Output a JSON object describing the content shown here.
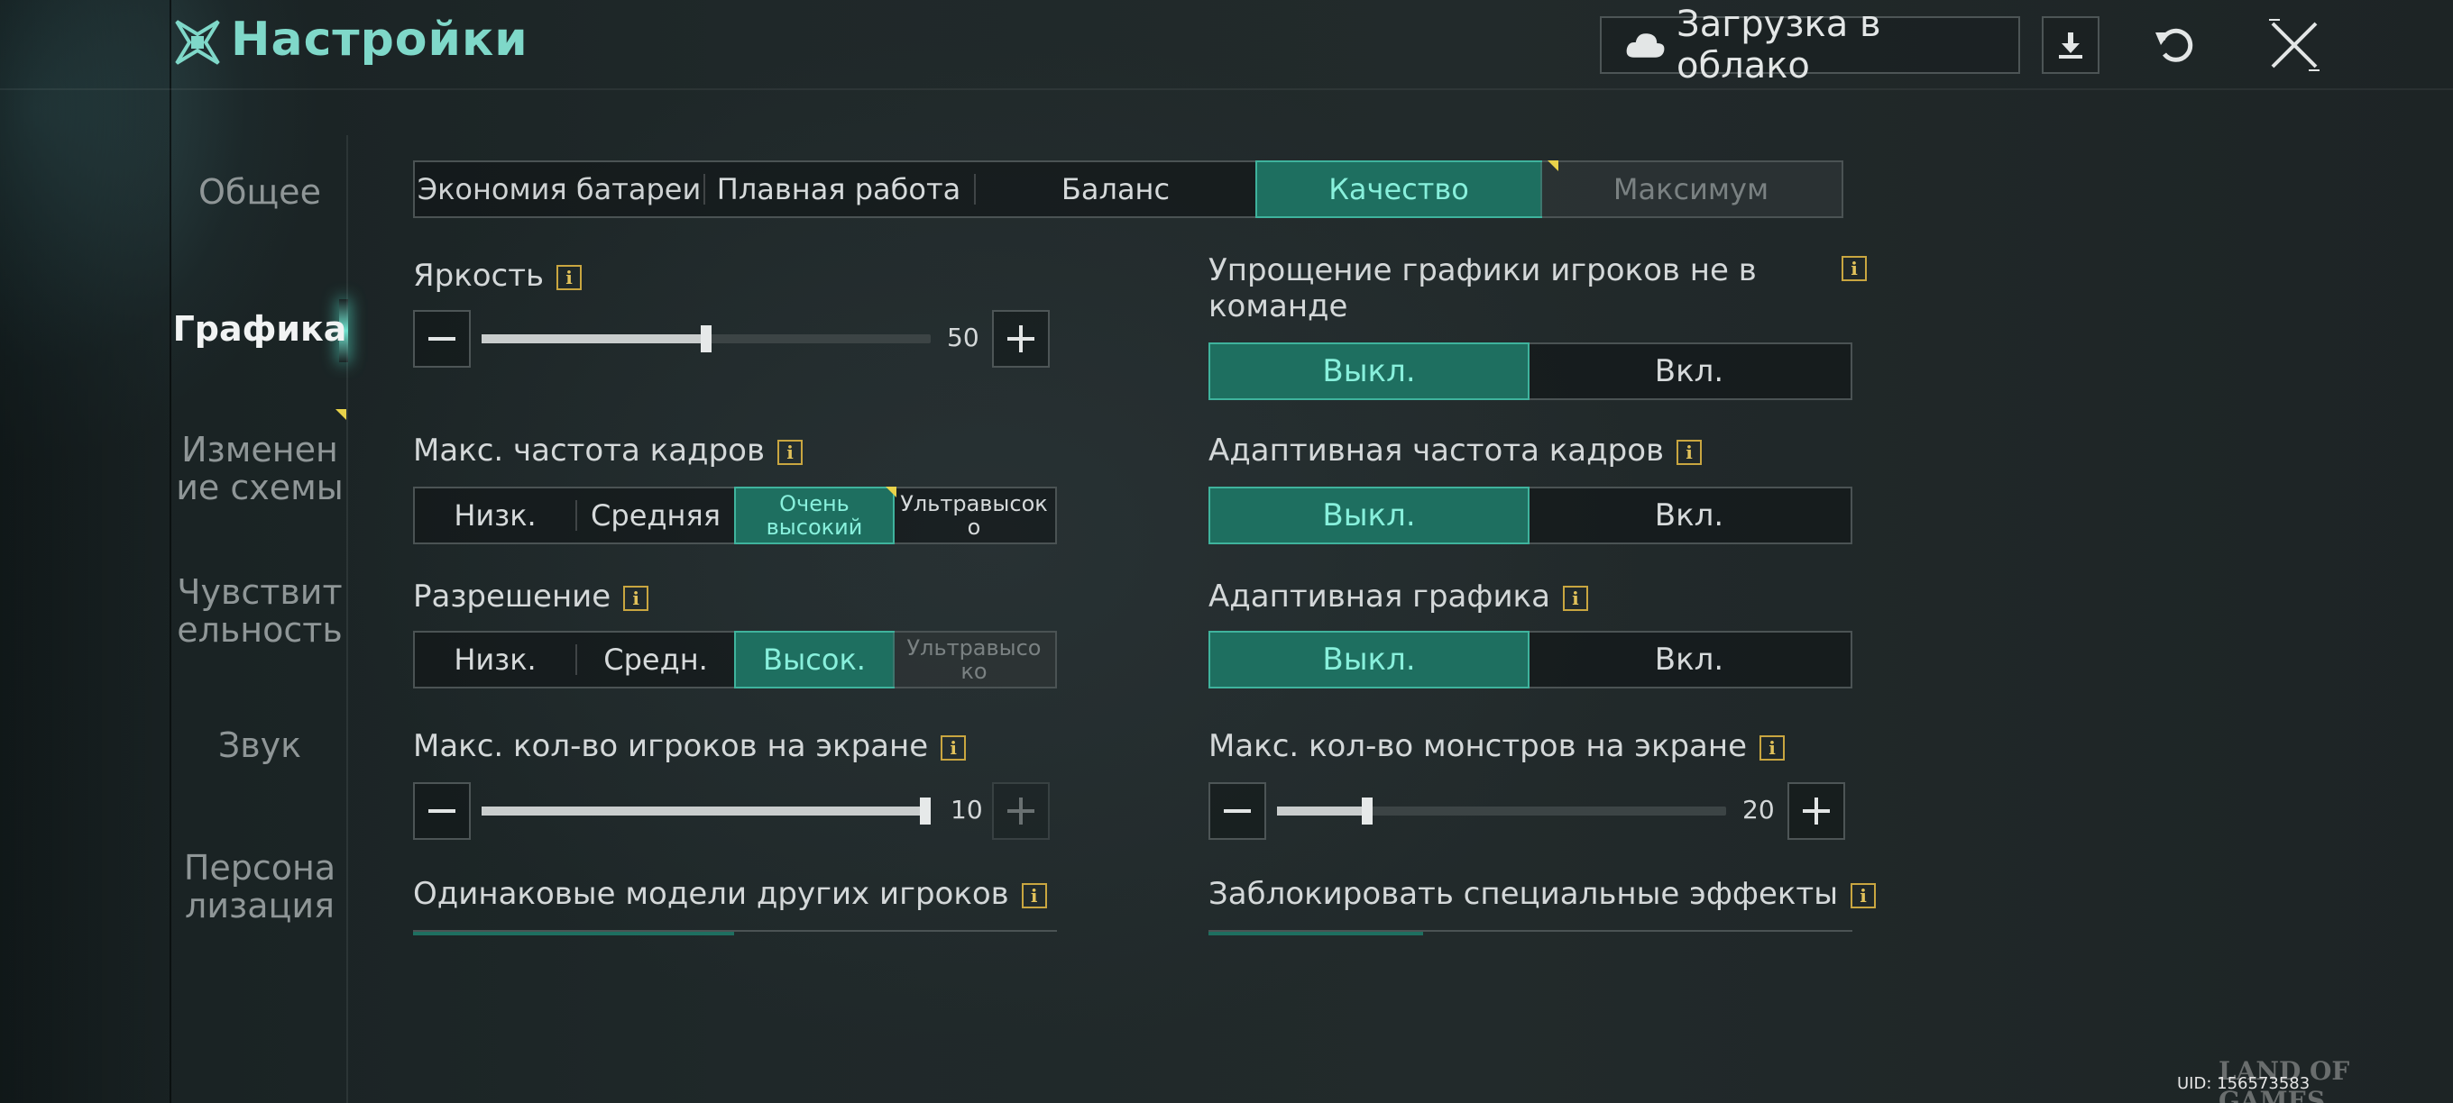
{
  "header": {
    "title": "Настройки",
    "cloud_label": "Загрузка в облако"
  },
  "sidebar": {
    "items": [
      {
        "label": "Общее"
      },
      {
        "label": "Графика"
      },
      {
        "label": "Изменен ие схемы"
      },
      {
        "label": "Чувствит ельность"
      },
      {
        "label": "Звук"
      },
      {
        "label": "Персона лизация"
      }
    ]
  },
  "presets": {
    "options": [
      "Экономия батареи",
      "Плавная работа",
      "Баланс",
      "Качество",
      "Максимум"
    ],
    "selected": "Качество"
  },
  "brightness": {
    "label": "Яркость",
    "value": "50",
    "fraction": 0.5
  },
  "fps": {
    "label": "Макс. частота кадров",
    "options": [
      "Низк.",
      "Средняя",
      "Очень высокий",
      "Ультравысок о"
    ],
    "selected": "Очень высокий"
  },
  "resolution": {
    "label": "Разрешение",
    "options": [
      "Низк.",
      "Средн.",
      "Высок.",
      "Ультравысо ко"
    ],
    "selected": "Высок."
  },
  "max_players": {
    "label": "Макс. кол-во игроков на экране",
    "value": "10",
    "fraction": 1.0
  },
  "same_models": {
    "label": "Одинаковые модели других игроков"
  },
  "simplify": {
    "label": "Упрощение графики игроков не в команде",
    "options": [
      "Выкл.",
      "Вкл."
    ],
    "selected": "Выкл."
  },
  "adaptive_fps": {
    "label": "Адаптивная частота кадров",
    "options": [
      "Выкл.",
      "Вкл."
    ],
    "selected": "Выкл."
  },
  "adaptive_graphics": {
    "label": "Адаптивная графика",
    "options": [
      "Выкл.",
      "Вкл."
    ],
    "selected": "Выкл."
  },
  "max_monsters": {
    "label": "Макс. кол-во монстров на экране",
    "value": "20",
    "fraction": 0.2
  },
  "block_effects": {
    "label": "Заблокировать специальные эффекты"
  },
  "footer": {
    "watermark": "LAND OF GAMES",
    "uid": "UID: 156573583"
  },
  "colors": {
    "accent": "#7fd8c9",
    "active_bg": "#1e6f60",
    "info": "#c9a640"
  }
}
